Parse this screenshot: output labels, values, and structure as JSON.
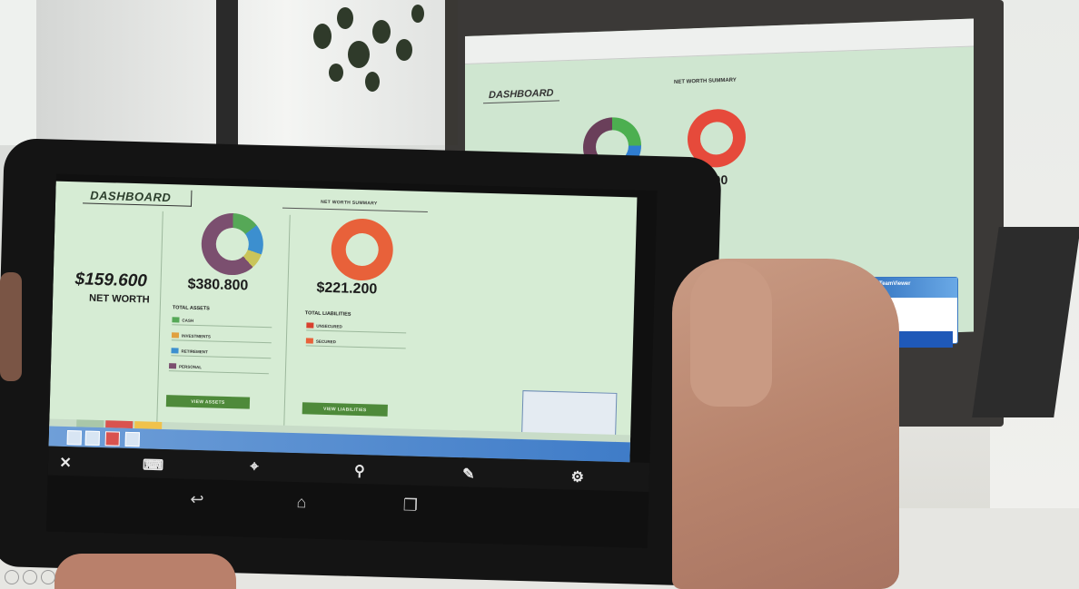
{
  "laptop": {
    "dashboard_title": "DASHBOARD",
    "summary_label": "NET WORTH SUMMARY",
    "partial_value": ".200",
    "teamviewer_label": "TeamViewer"
  },
  "tablet": {
    "dashboard_title": "DASHBOARD",
    "summary_label": "NET WORTH SUMMARY",
    "net_worth": {
      "value": "$159.600",
      "label": "NET WORTH"
    },
    "assets": {
      "value": "$380.800",
      "heading": "TOTAL ASSETS",
      "items": [
        {
          "label": "CASH",
          "color": "#56a857"
        },
        {
          "label": "INVESTMENTS",
          "color": "#e0a040"
        },
        {
          "label": "RETIREMENT",
          "color": "#3c8fcf"
        },
        {
          "label": "PERSONAL",
          "color": "#7b4f6f"
        }
      ],
      "button": "VIEW ASSETS"
    },
    "liabilities": {
      "value": "$221.200",
      "heading": "TOTAL LIABILITIES",
      "items": [
        {
          "label": "UNSECURED",
          "color": "#d8402e"
        },
        {
          "label": "SECURED",
          "color": "#e8613a"
        }
      ],
      "button": "VIEW LIABILITIES"
    },
    "toolbar_icons": [
      "close-icon",
      "keyboard-icon",
      "mouse-icon",
      "search-icon",
      "wrench-icon",
      "gear-icon"
    ],
    "nav_icons": [
      "back-icon",
      "home-icon",
      "recent-apps-icon"
    ]
  }
}
